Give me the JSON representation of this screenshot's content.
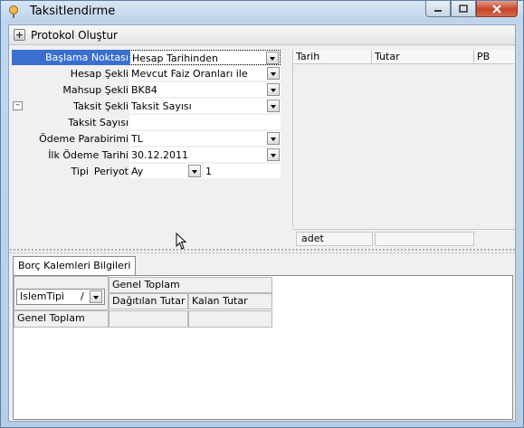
{
  "window": {
    "title": "Taksitlendirme"
  },
  "header": {
    "title": "Protokol Oluştur"
  },
  "form": {
    "rows": [
      {
        "label": "Başlama Noktası",
        "value": "Hesap Tarihinden",
        "dropdown": true
      },
      {
        "label": "Hesap Şekli",
        "value": "Mevcut Faiz Oranları ile",
        "dropdown": true
      },
      {
        "label": "Mahsup Şekli",
        "value": "BK84",
        "dropdown": true
      },
      {
        "label": "Taksit Şekli",
        "value": "Taksit Sayısı",
        "dropdown": true
      },
      {
        "label": "Taksit Sayısı",
        "value": "",
        "dropdown": false
      },
      {
        "label": "Ödeme Parabirimi",
        "value": "TL",
        "dropdown": true
      },
      {
        "label": "İlk Ödeme Tarihi",
        "value": "30.12.2011",
        "dropdown": true
      }
    ],
    "tipi": {
      "label": "Tipi",
      "periyot_label": "Periyot",
      "periyot_value": "Ay",
      "count_value": "1"
    },
    "minus_button": "–"
  },
  "grid": {
    "columns": [
      "Tarih",
      "Tutar",
      "PB"
    ],
    "footer": {
      "count_unit": "adet"
    }
  },
  "tab": {
    "label": "Borç Kalemleri Bilgileri"
  },
  "pivot": {
    "row_field": "IslemTipi",
    "group_header": "Genel Toplam",
    "col_distributed": "Dağıtılan Tutar",
    "col_remaining": "Kalan Tutar",
    "total_row": "Genel Toplam",
    "sort_glyph": "/"
  },
  "colors": {
    "selection": "#3a6fd0",
    "close_button": "#c5442b"
  }
}
